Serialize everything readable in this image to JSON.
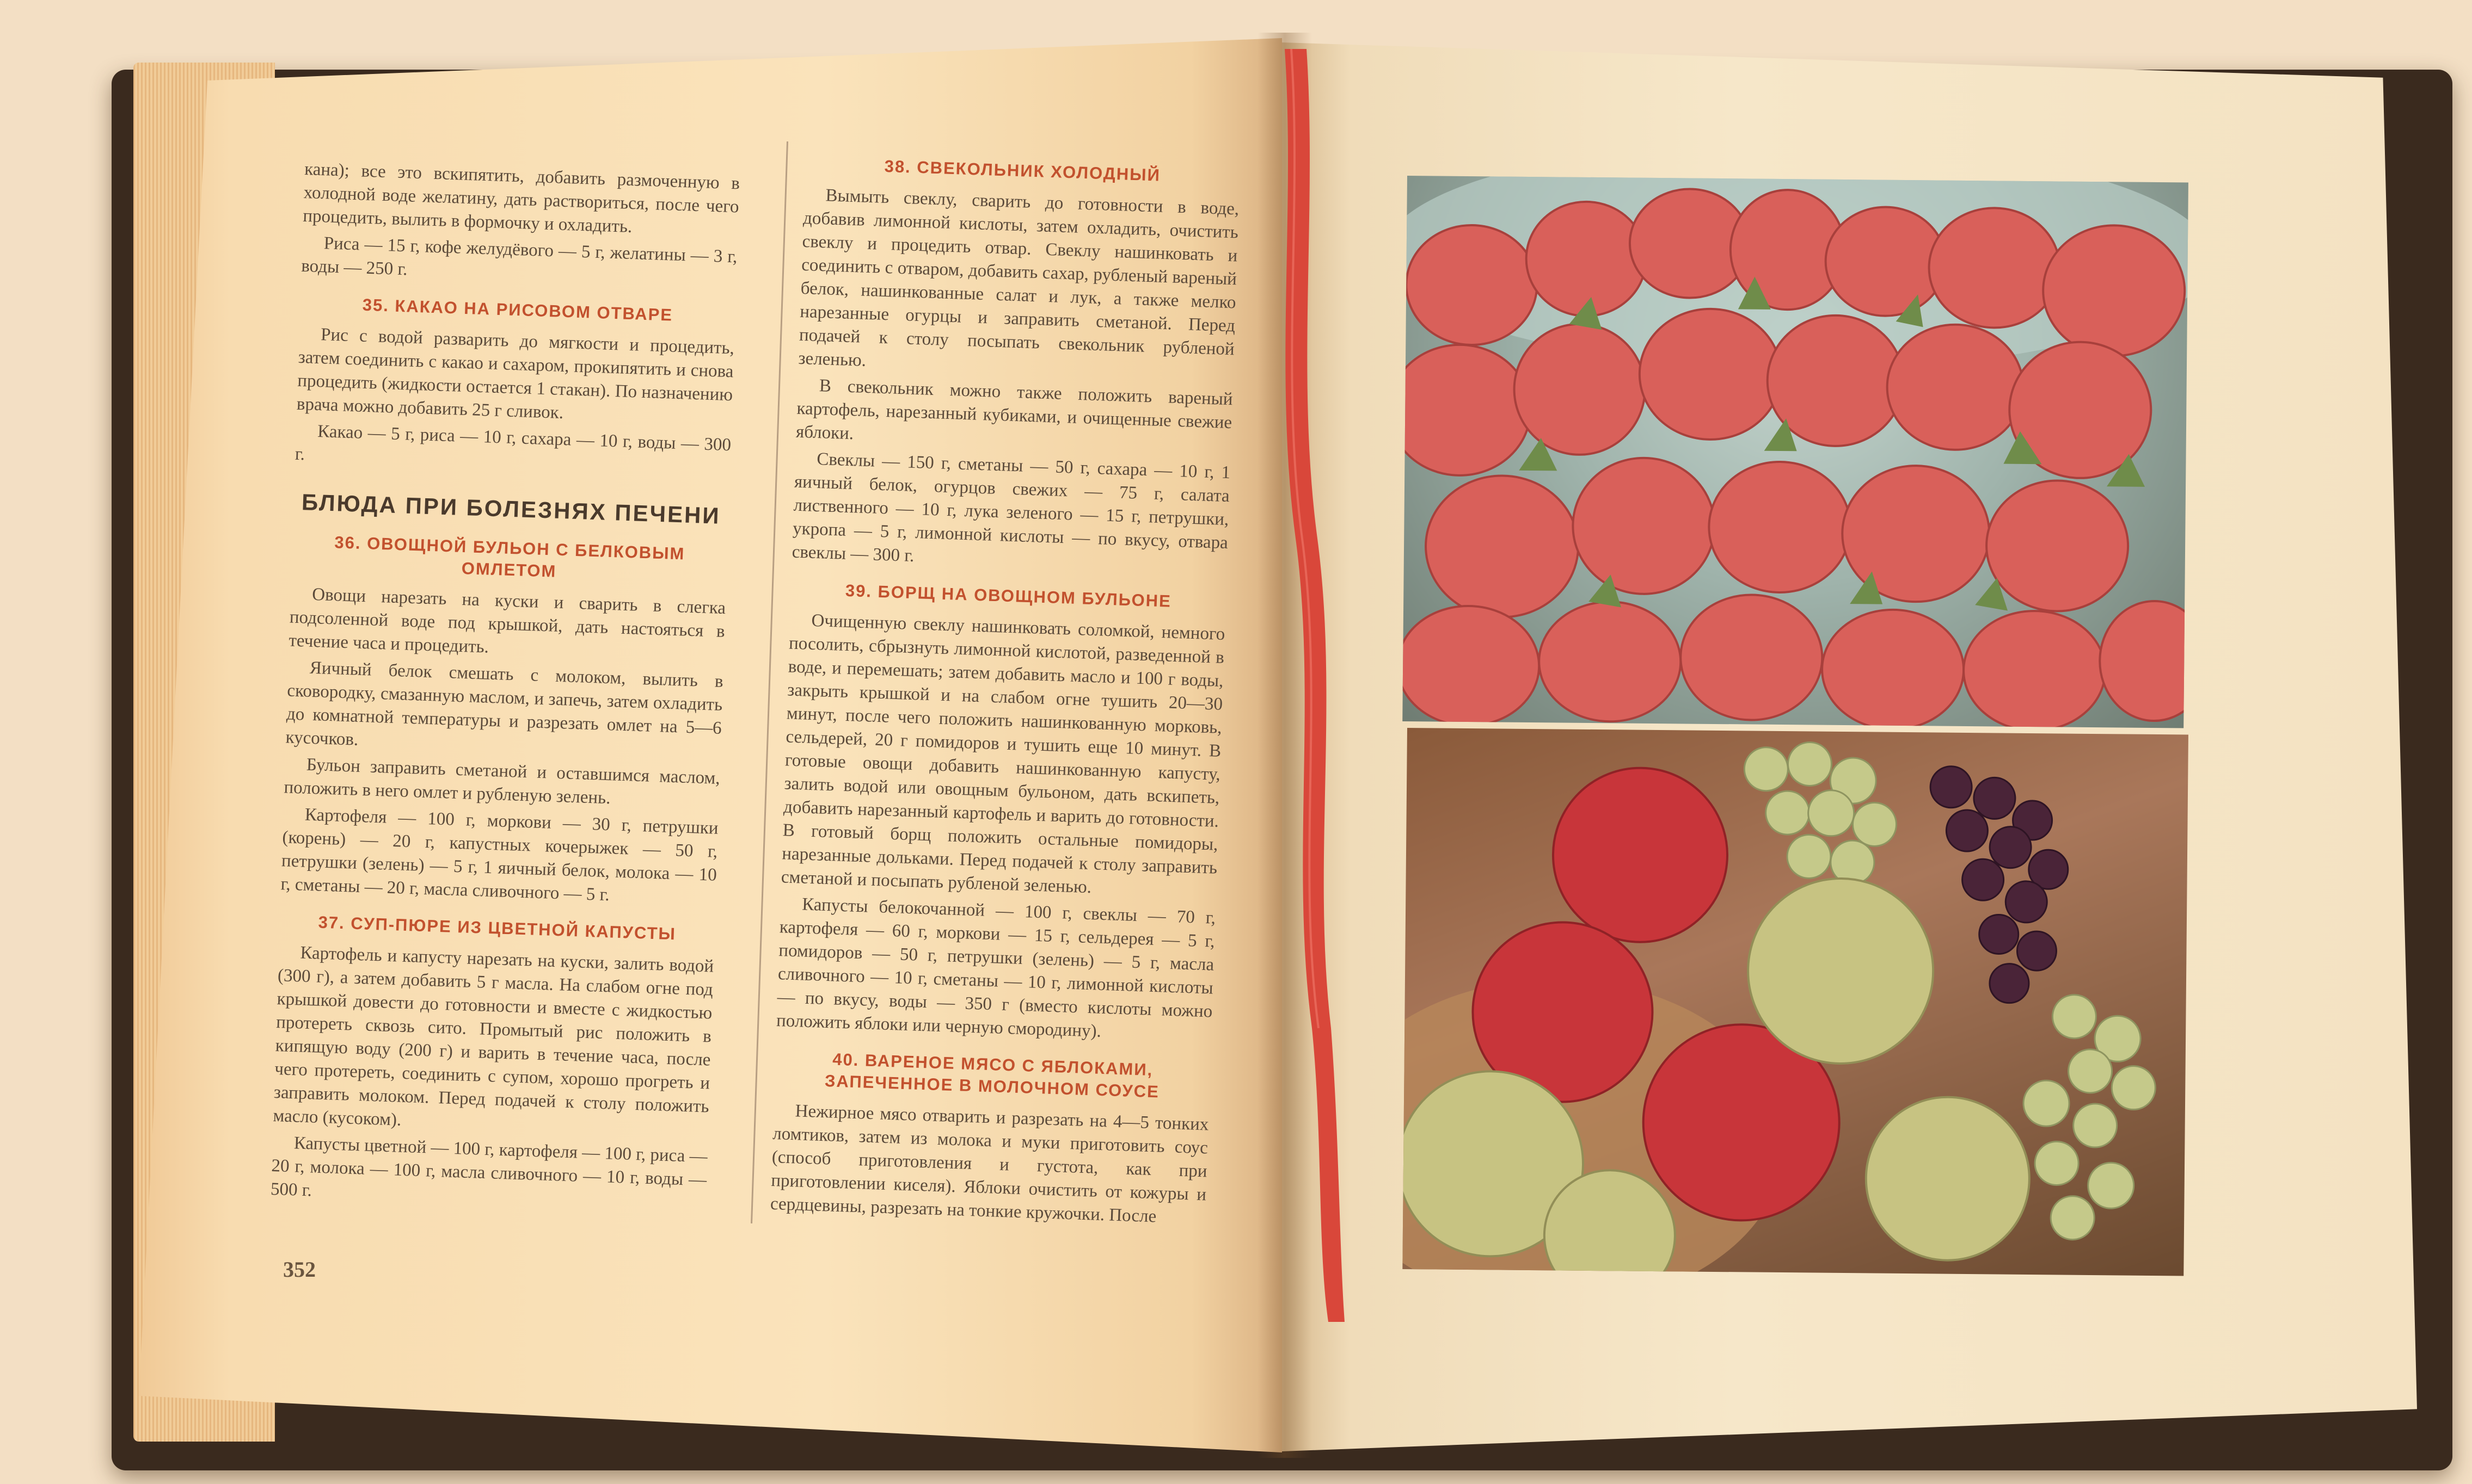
{
  "left_page": {
    "page_number": "352",
    "intro": [
      "кана); все это вскипятить, добавить размоченную в холодной воде желатину, дать раствориться, после чего процедить, вылить в формочку и охладить.",
      "Риса — 15 г, кофе желудёвого — 5 г, желатины — 3 г, воды — 250 г."
    ],
    "recipe35": {
      "title": "35. КАКАО НА РИСОВОМ ОТВАРЕ",
      "paragraphs": [
        "Рис с водой разварить до мягкости и процедить, затем соединить с какао и сахаром, прокипятить и снова процедить (жидкости остается 1 стакан). По назначению врача можно добавить 25 г сливок.",
        "Какао — 5 г, риса — 10 г, сахара — 10 г, воды — 300 г."
      ]
    },
    "section_heading": "БЛЮДА ПРИ БОЛЕЗНЯХ ПЕЧЕНИ",
    "recipe36": {
      "title": "36. ОВОЩНОЙ БУЛЬОН С БЕЛКОВЫМ ОМЛЕТОМ",
      "paragraphs": [
        "Овощи нарезать на куски и сварить в слегка подсоленной воде под крышкой, дать настояться в течение часа и процедить.",
        "Яичный белок смешать с молоком, вылить в сковородку, смазанную маслом, и запечь, затем охладить до комнатной температуры и разрезать омлет на 5—6 кусочков.",
        "Бульон заправить сметаной и оставшимся маслом, положить в него омлет и рубленую зелень.",
        "Картофеля — 100 г, моркови — 30 г, петрушки (корень) — 20 г, капустных кочерыжек — 50 г, петрушки (зелень) — 5 г, 1 яичный белок, молока — 10 г, сметаны — 20 г, масла сливочного — 5 г."
      ]
    },
    "recipe37": {
      "title": "37. СУП-ПЮРЕ ИЗ ЦВЕТНОЙ КАПУСТЫ",
      "paragraphs": [
        "Картофель и капусту нарезать на куски, залить водой (300 г), а затем добавить 5 г масла. На слабом огне под крышкой довести до готовности и вместе с жидкостью протереть сквозь сито. Промытый рис положить в кипящую воду (200 г) и варить в течение часа, после чего протереть, соединить с супом, хорошо прогреть и заправить молоком. Перед подачей к столу положить масло (кусоком).",
        "Капусты цветной — 100 г, картофеля — 100 г, риса — 20 г, молока — 100 г, масла сливочного — 10 г, воды — 500 г."
      ]
    },
    "recipe38": {
      "title": "38. СВЕКОЛЬНИК ХОЛОДНЫЙ",
      "paragraphs": [
        "Вымыть свеклу, сварить до готовности в воде, добавив лимонной кислоты, затем охладить, очистить свеклу и процедить отвар. Свеклу нашинковать и соединить с отваром, добавить сахар, рубленый вареный белок, нашинкованные салат и лук, а также мелко нарезанные огурцы и заправить сметаной. Перед подачей к столу посыпать свекольник рубленой зеленью.",
        "В свекольник можно также положить вареный картофель, нарезанный кубиками, и очищенные свежие яблоки.",
        "Свеклы — 150 г, сметаны — 50 г, сахара — 10 г, 1 яичный белок, огурцов свежих — 75 г, салата лиственного — 10 г, лука зеленого — 15 г, петрушки, укропа — 5 г, лимонной кислоты — по вкусу, отвара свеклы — 300 г."
      ]
    },
    "recipe39": {
      "title": "39. БОРЩ НА ОВОЩНОМ БУЛЬОНЕ",
      "paragraphs": [
        "Очищенную свеклу нашинковать соломкой, немного посолить, сбрызнуть лимонной кислотой, разведенной в воде, и перемешать; затем добавить масло и 100 г воды, закрыть крышкой и на слабом огне тушить 20—30 минут, после чего положить нашинкованную морковь, сельдерей, 20 г помидоров и тушить еще 10 минут. В готовые овощи добавить нашинкованную капусту, залить водой или овощным бульоном, дать вскипеть, добавить нарезанный картофель и варить до готовности. В готовый борщ положить остальные помидоры, нарезанные дольками. Перед подачей к столу заправить сметаной и посыпать рубленой зеленью.",
        "Капусты белокочанной — 100 г, свеклы — 70 г, картофеля — 60 г, моркови — 15 г, сельдерея — 5 г, помидоров — 50 г, петрушки (зелень) — 5 г, масла сливочного — 10 г, сметаны — 10 г, лимонной кислоты — по вкусу, воды — 350 г (вместо кислоты можно положить яблоки или черную смородину)."
      ]
    },
    "recipe40": {
      "title": "40. ВАРЕНОЕ МЯСО С ЯБЛОКАМИ, ЗАПЕЧЕННОЕ В МОЛОЧНОМ СОУСЕ",
      "paragraphs": [
        "Нежирное мясо отварить и разрезать на 4—5 тонких ломтиков, затем из молока и муки приготовить соус (способ приготовления и густота, как при приготовлении киселя). Яблоки очистить от кожуры и сердцевины, разрезать на тонкие кружочки. После"
      ]
    }
  },
  "right_page": {
    "photos": [
      "strawberries-photo",
      "fruit-basket-photo"
    ]
  },
  "colors": {
    "heading_red": "#c2512e",
    "body_text": "#5b4a3a",
    "ribbon": "#d9473a"
  }
}
